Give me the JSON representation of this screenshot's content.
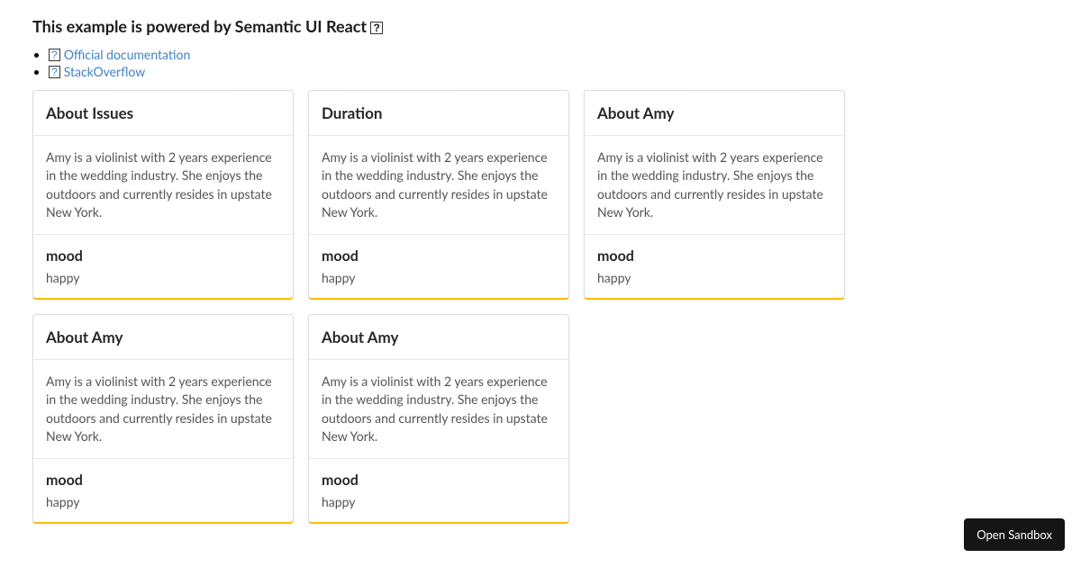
{
  "header": {
    "title": "This example is powered by Semantic UI React",
    "title_icon": "?"
  },
  "links": [
    {
      "icon": "?",
      "label": "Official documentation"
    },
    {
      "icon": "?",
      "label": "StackOverflow"
    }
  ],
  "card_description": "Amy is a violinist with 2 years experience in the wedding industry. She enjoys the outdoors and currently resides in upstate New York.",
  "mood_label": "mood",
  "mood_value": "happy",
  "cards": [
    {
      "title": "About Issues"
    },
    {
      "title": "Duration"
    },
    {
      "title": "About Amy"
    },
    {
      "title": "About Amy"
    },
    {
      "title": "About Amy"
    }
  ],
  "sandbox_button": "Open Sandbox"
}
